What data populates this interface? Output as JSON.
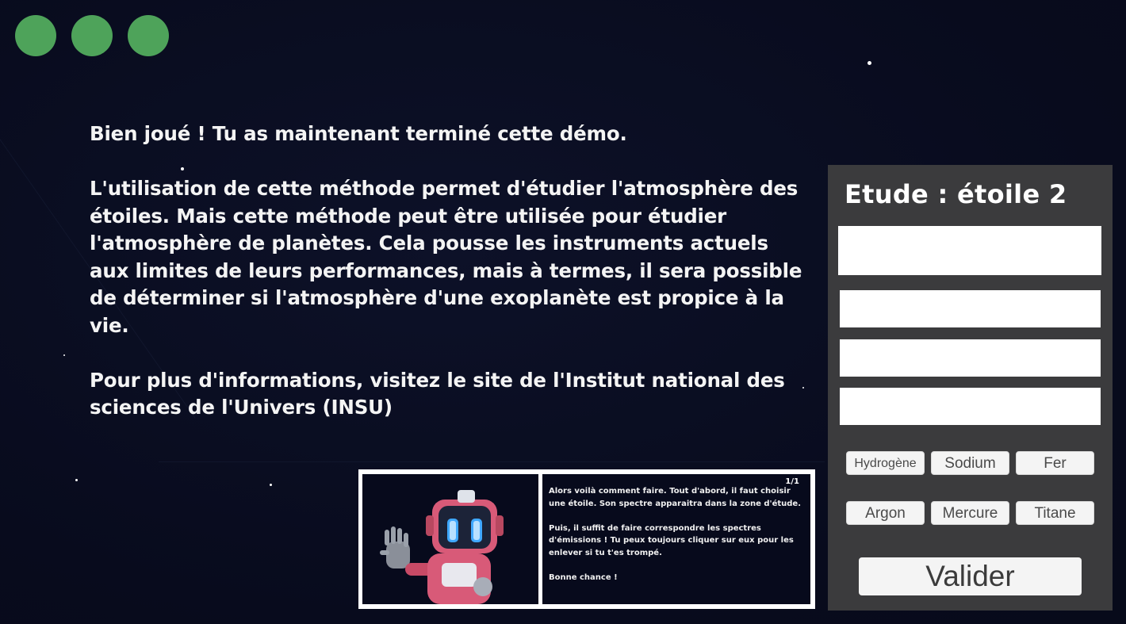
{
  "window_controls": [
    {
      "name": "control-1"
    },
    {
      "name": "control-2"
    },
    {
      "name": "control-3"
    }
  ],
  "message": {
    "paragraphs": [
      "Bien joué ! Tu as maintenant terminé cette démo.",
      "L'utilisation de cette méthode permet d'étudier l'atmosphère des étoiles. Mais cette méthode peut être utilisée pour étudier l'atmosphère de planètes. Cela pousse les instruments actuels aux limites de leurs performances, mais à termes, il sera possible de déterminer si l'atmosphère d'une exoplanète est propice à la vie.",
      "Pour plus d'informations, visitez le site de l'Institut national des sciences de l'Univers (INSU)"
    ]
  },
  "study_panel": {
    "title": "Etude : étoile 2",
    "elements_row1": [
      "Hydrogène",
      "Sodium",
      "Fer"
    ],
    "elements_row2": [
      "Argon",
      "Mercure",
      "Titane"
    ],
    "validate_label": "Valider"
  },
  "dialog": {
    "counter": "1/1",
    "paragraphs": [
      "Alors voilà comment faire. Tout d'abord, il faut choisir une étoile. Son spectre apparaitra dans la zone d'étude.",
      "Puis, il suffit de faire correspondre les spectres d'émissions ! Tu peux toujours cliquer sur eux pour les enlever si tu t'es trompé.",
      "Bonne chance !"
    ]
  },
  "colors": {
    "background": "#0a0d22",
    "control_green": "#4ea35a",
    "panel_gray": "#3b3b3d",
    "robot_pink": "#d85a78",
    "robot_eyes": "#3fa8ff"
  }
}
